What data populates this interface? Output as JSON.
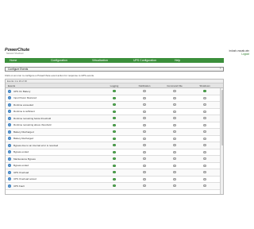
{
  "brand": {
    "title": "PowerChute",
    "subtitle": "Network Shutdown"
  },
  "host": {
    "name": "indush-vwcab-win",
    "logout": "Logout"
  },
  "nav": [
    "Home",
    "Configuration",
    "Virtualization",
    "UPS Configuration",
    "Help"
  ],
  "section": {
    "title": "Configure Events",
    "description": "Click on an icon to configure a PowerChute event action for response to UPS events."
  },
  "table": {
    "count": "Events 1 to 20 of 30",
    "headers": {
      "event": "Events",
      "logging": "Logging",
      "notification": "Notification",
      "command": "Command File",
      "shutdown": "Shutdown"
    },
    "rows": [
      {
        "event": "UPS On Battery",
        "logging": true,
        "notification": false,
        "command": false,
        "shutdown": true
      },
      {
        "event": "Input Power Restored",
        "logging": true,
        "notification": false,
        "command": false,
        "shutdown": false
      },
      {
        "event": "Runtime exceeded",
        "logging": true,
        "notification": false,
        "command": false,
        "shutdown": false
      },
      {
        "event": "Runtime is sufficient",
        "logging": true,
        "notification": false,
        "command": false,
        "shutdown": false
      },
      {
        "event": "Runtime remaining below threshold",
        "logging": true,
        "notification": false,
        "command": false,
        "shutdown": false
      },
      {
        "event": "Runtime remaining above threshold",
        "logging": true,
        "notification": false,
        "command": false,
        "shutdown": false
      },
      {
        "event": "Battery Discharged",
        "logging": true,
        "notification": false,
        "command": false,
        "shutdown": false
      },
      {
        "event": "Battery Recharged",
        "logging": true,
        "notification": false,
        "command": false,
        "shutdown": false
      },
      {
        "event": "Bypass due to an internal error is resolved",
        "logging": true,
        "notification": false,
        "command": false,
        "shutdown": false
      },
      {
        "event": "Bypass ended",
        "logging": true,
        "notification": false,
        "command": false,
        "shutdown": false
      },
      {
        "event": "Maintenance Bypass",
        "logging": true,
        "notification": false,
        "command": false,
        "shutdown": false
      },
      {
        "event": "Bypass ended",
        "logging": true,
        "notification": false,
        "command": false,
        "shutdown": false
      },
      {
        "event": "UPS Overload",
        "logging": true,
        "notification": false,
        "command": false,
        "shutdown": false
      },
      {
        "event": "UPS Overload solved",
        "logging": true,
        "notification": false,
        "command": false,
        "shutdown": false
      },
      {
        "event": "UPS Fault",
        "logging": true,
        "notification": false,
        "command": false,
        "shutdown": false
      }
    ]
  }
}
